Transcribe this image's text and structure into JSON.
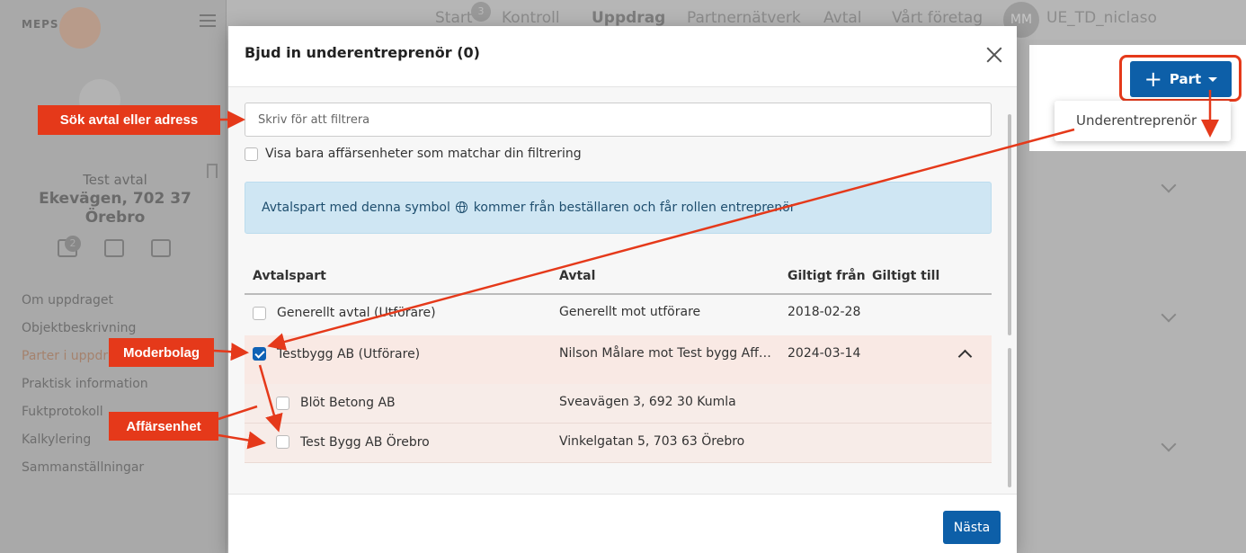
{
  "app": {
    "logo_text": "MEPS",
    "nav": [
      "Start",
      "Kontroll",
      "Uppdrag",
      "Partnernätverk",
      "Avtal",
      "Vårt företag"
    ],
    "nav_badge": "3",
    "avatar_initials": "MM",
    "username": "UE_TD_niclaso"
  },
  "sidebar": {
    "contract_title": "Test avtal",
    "contract_address_line1": "Ekevägen, 702 37",
    "contract_address_line2": "Örebro",
    "icon_badge": "2",
    "menu": [
      "Om uppdraget",
      "Objektbeskrivning",
      "Parter i uppdr",
      "Praktisk information",
      "Fuktprotokoll",
      "Kalkylering",
      "Sammanställningar"
    ]
  },
  "part_button": {
    "label": "Part",
    "dropdown_item": "Underentreprenör"
  },
  "modal": {
    "title": "Bjud in underentreprenör (0)",
    "filter_placeholder": "Skriv för att filtrera",
    "only_matching_label": "Visa bara affärsenheter som matchar din filtrering",
    "info_before": "Avtalspart med denna symbol",
    "info_after": "kommer från beställaren och får rollen entreprenör",
    "columns": {
      "party": "Avtalspart",
      "contract": "Avtal",
      "valid_from": "Giltigt från",
      "valid_to": "Giltigt till"
    },
    "rows": [
      {
        "party": "Generellt avtal (Utförare)",
        "contract": "Generellt mot utförare",
        "valid_from": "2018-02-28",
        "valid_to": "",
        "checked": false
      },
      {
        "party": "Testbygg AB (Utförare)",
        "contract": "Nilson Målare mot Test bygg Aff…",
        "valid_from": "2024-03-14",
        "valid_to": "",
        "checked": true
      }
    ],
    "subrows": [
      {
        "party": "Blöt Betong AB",
        "contract": "Sveavägen 3, 692 30 Kumla",
        "checked": false
      },
      {
        "party": "Test Bygg AB Örebro",
        "contract": "Vinkelgatan 5, 703 63 Örebro",
        "checked": false
      }
    ],
    "next_label": "Nästa"
  },
  "annotations": {
    "search": "Sök avtal eller adress",
    "parent": "Moderbolag",
    "business_unit": "Affärsenhet"
  },
  "colors": {
    "accent": "#0d5fa8",
    "annotation": "#e5391a",
    "info_bg": "#cfe6f3"
  }
}
